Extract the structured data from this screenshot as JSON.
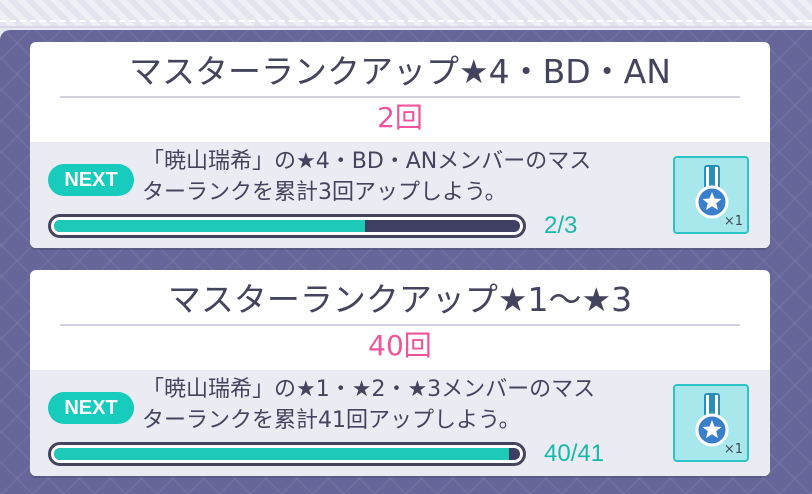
{
  "missions": [
    {
      "title": "マスターランクアップ★4・BD・AN",
      "count": "2回",
      "next_label": "NEXT",
      "description_line1": "「暁山瑞希」の★4・BD・ANメンバーのマス",
      "description_line2": "ターランクを累計3回アップしよう。",
      "progress_text": "2/3",
      "progress_fraction": 0.667,
      "reward_icon": "medal-icon",
      "reward_quantity": "×1"
    },
    {
      "title": "マスターランクアップ★1～★3",
      "count": "40回",
      "next_label": "NEXT",
      "description_line1": "「暁山瑞希」の★1・★2・★3メンバーのマス",
      "description_line2": "ターランクを累計41回アップしよう。",
      "progress_text": "40/41",
      "progress_fraction": 0.976,
      "reward_icon": "medal-icon",
      "reward_quantity": "×1"
    }
  ],
  "colors": {
    "panel": "#66669a",
    "count": "#f0559c",
    "accent": "#1fc9b7",
    "text": "#44445e"
  }
}
